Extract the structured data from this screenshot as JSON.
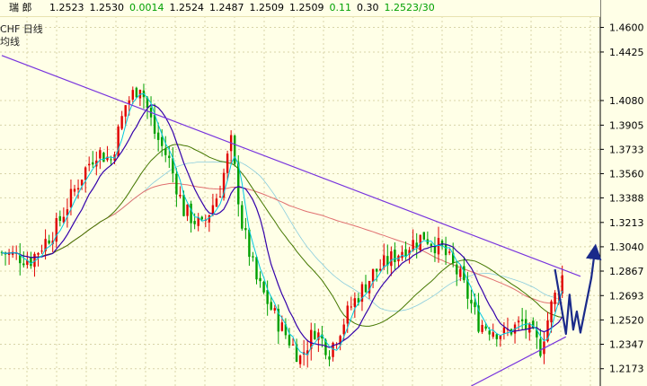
{
  "header": {
    "name": "瑞  郎",
    "quote_vals": [
      "1.2523",
      "1.2530",
      "0.0014",
      "1.2524",
      "1.2487",
      "1.2509",
      "1.2509",
      "0.11",
      "0.30",
      "1.2523/30"
    ],
    "quote_colors": [
      "#000000",
      "#000000",
      "#00A000",
      "#000000",
      "#000000",
      "#000000",
      "#000000",
      "#00A000",
      "#000000",
      "#00A000"
    ]
  },
  "pair_label": "CHF  日线",
  "indicator_label": "均线",
  "colors": {
    "background": "#FFFFE7",
    "grid": "#D8D4A8",
    "candle_up": "#E00000",
    "candle_down": "#00A000",
    "trendline": "#7733DD",
    "ma_short": "#00C8E0",
    "ma_mid": "#3300AA",
    "ma_long": "#447700",
    "ma_longest": "#E07070",
    "ma_faint": "#88CCDD",
    "projection": "#1A2A8A"
  },
  "chart_data": {
    "type": "candlestick",
    "ylim": [
      1.205,
      1.468
    ],
    "y_ticks": [
      "1.4600",
      "1.4425",
      "1.4080",
      "1.3905",
      "1.3733",
      "1.3560",
      "1.3388",
      "1.3213",
      "1.3040",
      "1.2867",
      "1.2693",
      "1.2520",
      "1.2347",
      "1.2173"
    ],
    "candle_count": 155,
    "price_path": [
      [
        0,
        1.3
      ],
      [
        8,
        1.295
      ],
      [
        15,
        1.318
      ],
      [
        22,
        1.355
      ],
      [
        26,
        1.372
      ],
      [
        30,
        1.366
      ],
      [
        34,
        1.405
      ],
      [
        38,
        1.42
      ],
      [
        42,
        1.385
      ],
      [
        46,
        1.365
      ],
      [
        50,
        1.33
      ],
      [
        55,
        1.318
      ],
      [
        60,
        1.345
      ],
      [
        63,
        1.378
      ],
      [
        66,
        1.32
      ],
      [
        70,
        1.28
      ],
      [
        76,
        1.25
      ],
      [
        82,
        1.225
      ],
      [
        86,
        1.245
      ],
      [
        90,
        1.23
      ],
      [
        96,
        1.262
      ],
      [
        102,
        1.285
      ],
      [
        110,
        1.302
      ],
      [
        116,
        1.312
      ],
      [
        121,
        1.302
      ],
      [
        126,
        1.282
      ],
      [
        131,
        1.25
      ],
      [
        138,
        1.242
      ],
      [
        143,
        1.25
      ],
      [
        148,
        1.232
      ],
      [
        151,
        1.262
      ],
      [
        154,
        1.283
      ]
    ],
    "trendlines": [
      {
        "name": "resistance",
        "from": [
          0,
          1.44
        ],
        "to": [
          159,
          1.283
        ]
      },
      {
        "name": "support",
        "from": [
          129,
          1.205
        ],
        "to": [
          155,
          1.24
        ]
      }
    ],
    "projection_path": [
      [
        152,
        1.288
      ],
      [
        155,
        1.242
      ],
      [
        156,
        1.27
      ],
      [
        157,
        1.245
      ],
      [
        158,
        1.258
      ],
      [
        159,
        1.243
      ],
      [
        162,
        1.282
      ],
      [
        163,
        1.302
      ]
    ]
  }
}
